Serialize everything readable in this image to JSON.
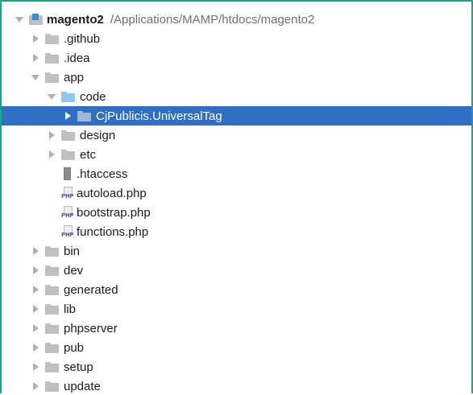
{
  "tree": {
    "root": {
      "name": "magento2",
      "path": "/Applications/MAMP/htdocs/magento2"
    },
    "items": [
      {
        "label": ".github"
      },
      {
        "label": ".idea"
      },
      {
        "label": "app"
      },
      {
        "label": "code"
      },
      {
        "label": "CjPublicis.UniversalTag"
      },
      {
        "label": "design"
      },
      {
        "label": "etc"
      },
      {
        "label": ".htaccess"
      },
      {
        "label": "autoload.php"
      },
      {
        "label": "bootstrap.php"
      },
      {
        "label": "functions.php"
      },
      {
        "label": "bin"
      },
      {
        "label": "dev"
      },
      {
        "label": "generated"
      },
      {
        "label": "lib"
      },
      {
        "label": "phpserver"
      },
      {
        "label": "pub"
      },
      {
        "label": "setup"
      },
      {
        "label": "update"
      }
    ]
  },
  "icons": {
    "folder": "folder-icon",
    "module": "module-folder-icon",
    "file": "file-icon",
    "php": "php-file-icon"
  },
  "colors": {
    "selection": "#2f6fc4",
    "frame": "#16a589",
    "path": "#707070"
  }
}
